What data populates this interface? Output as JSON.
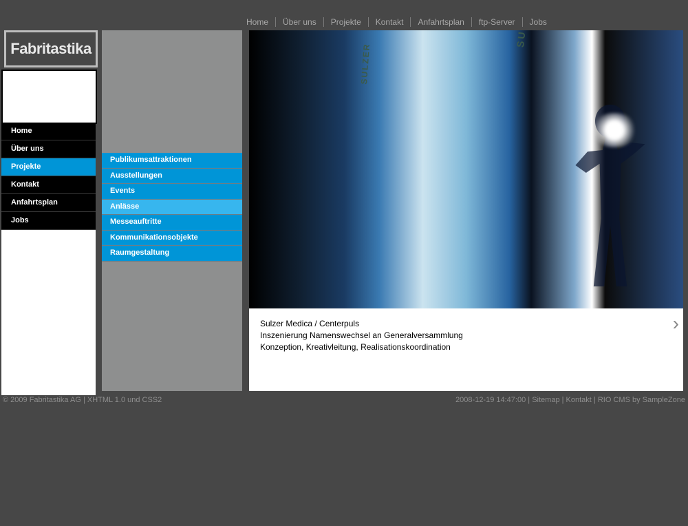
{
  "brand": "Fabritastika",
  "topnav": [
    {
      "label": "Home"
    },
    {
      "label": "Über uns"
    },
    {
      "label": "Projekte"
    },
    {
      "label": "Kontakt"
    },
    {
      "label": "Anfahrtsplan"
    },
    {
      "label": "ftp-Server"
    },
    {
      "label": "Jobs"
    }
  ],
  "sidebar": [
    {
      "label": "Home",
      "active": false
    },
    {
      "label": "Über uns",
      "active": false
    },
    {
      "label": "Projekte",
      "active": true
    },
    {
      "label": "Kontakt",
      "active": false
    },
    {
      "label": "Anfahrtsplan",
      "active": false
    },
    {
      "label": "Jobs",
      "active": false
    }
  ],
  "subnav": [
    {
      "label": "Publikumsattraktionen",
      "active": false
    },
    {
      "label": "Ausstellungen",
      "active": false
    },
    {
      "label": "Events",
      "active": false
    },
    {
      "label": "Anlässe",
      "active": true
    },
    {
      "label": "Messeauftritte",
      "active": false
    },
    {
      "label": "Kommunikationsobjekte",
      "active": false
    },
    {
      "label": "Raumgestaltung",
      "active": false
    }
  ],
  "hero": {
    "texttag": "SULZER",
    "texttag2": "SULZER ME",
    "caption_line1": "Sulzer Medica / Centerpuls",
    "caption_line2": "Inszenierung Namenswechsel an Generalversammlung",
    "caption_line3": "Konzeption, Kreativleitung, Realisationskoordination"
  },
  "footer": {
    "left_copyright": "© 2009 Fabritastika AG",
    "left_standards": "XHTML 1.0 und CSS2",
    "timestamp": "2008-12-19 14:47:00",
    "sitemap": "Sitemap",
    "kontakt": "Kontakt",
    "cms": "RIO CMS by SampleZone"
  },
  "sep": "  |  "
}
